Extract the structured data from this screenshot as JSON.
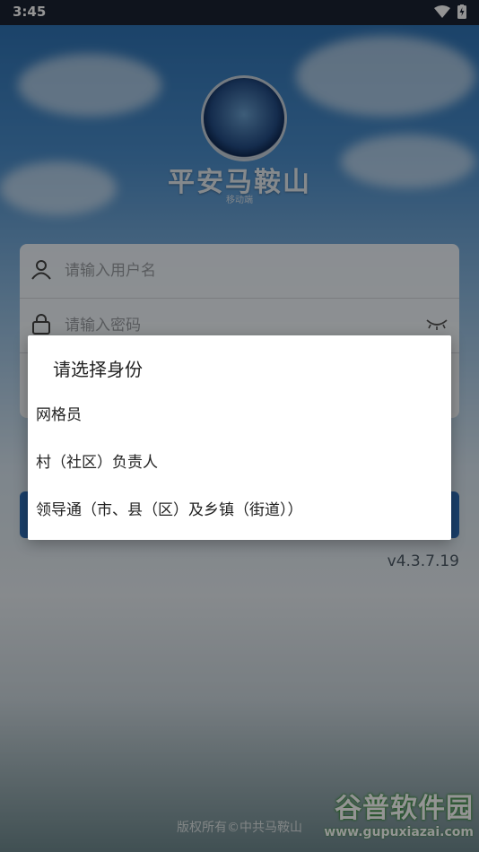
{
  "status_bar": {
    "time": "3:45"
  },
  "app": {
    "title": "平安马鞍山",
    "subtitle": "移动端",
    "emblem_text": "平安马鞍山"
  },
  "login": {
    "username_placeholder": "请输入用户名",
    "password_placeholder": "请输入密码",
    "version": "v4.3.7.19",
    "footer": "版权所有©中共马鞍山"
  },
  "dialog": {
    "title": "请选择身份",
    "options": [
      "网格员",
      "村（社区）负责人",
      "领导通（市、县（区）及乡镇（街道））"
    ]
  },
  "watermark": {
    "logo": "谷普软件园",
    "url": "www.gupuxiazai.com"
  }
}
